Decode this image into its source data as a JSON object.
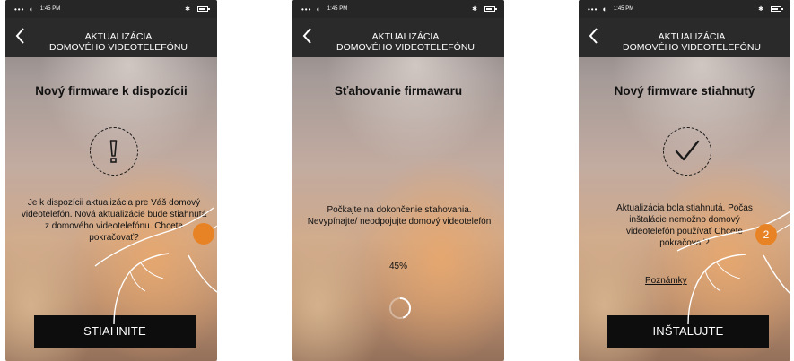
{
  "status_bar": {
    "signal": "•••",
    "time": "1:45 PM"
  },
  "header": {
    "title_line1": "AKTUALIZÁCIA",
    "title_line2": "DOMOVÉHO VIDEOTELEFÓNU"
  },
  "screens": [
    {
      "heading": "Nový firmware k dispozícii",
      "icon": "exclamation-icon",
      "message": "Je k dispozícii aktualizácia pre Váš domový videotelefón. Nová aktualizácie bude stiahnutá z domového videotelefónu. Chcete pokračovať?",
      "button": "STIAHNITE",
      "touch_marker": ""
    },
    {
      "heading": "Sťahovanie firmawaru",
      "message": "Počkajte na dokončenie sťahovania. Nevypínajte/ neodpojujte domový videotelefón",
      "progress_text": "45%",
      "progress": 0.45
    },
    {
      "heading": "Nový firmware stiahnutý",
      "icon": "checkmark-icon",
      "message": "Aktualizácia bola stiahnutá. Počas inštalácie nemožno domový videotelefón používať Chcete pokračovať?",
      "link": "Poznámky ",
      "button": "INŠTALUJTE",
      "touch_marker": "2"
    }
  ],
  "colors": {
    "header_bg": "#2a2a2a",
    "button_bg": "#0d0d0d",
    "touch_marker": "#e88325"
  }
}
